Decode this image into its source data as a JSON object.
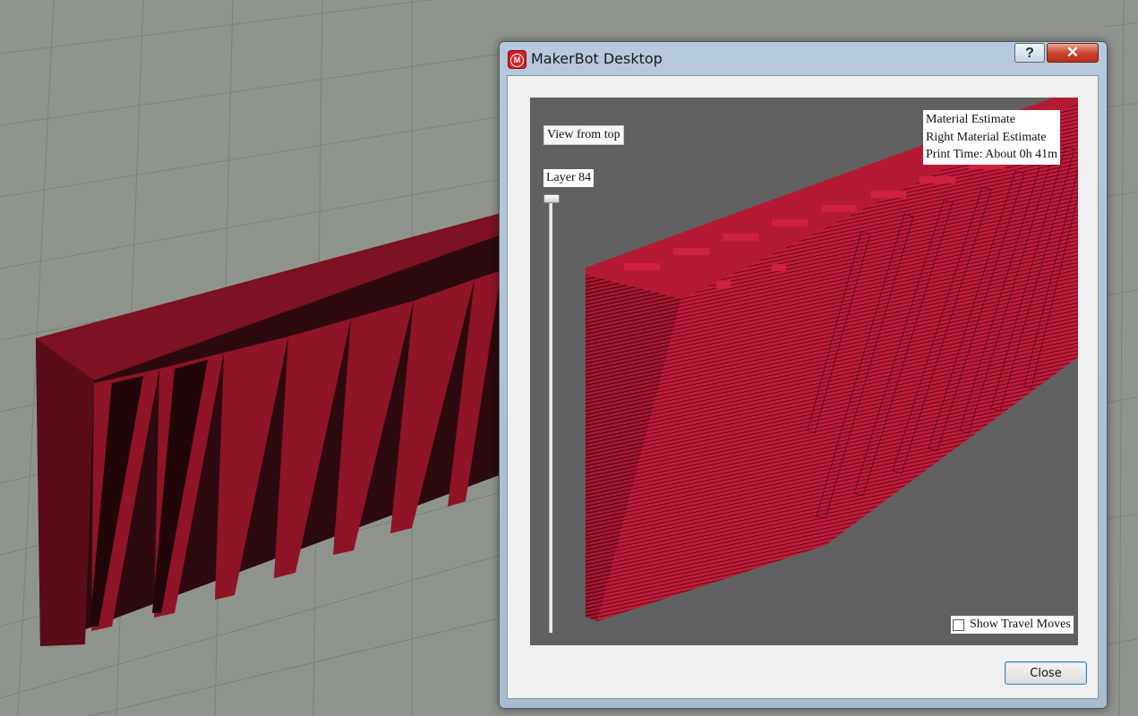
{
  "window": {
    "title": "MakerBot Desktop",
    "help_glyph": "?",
    "close_glyph": "✕",
    "logo_icon": "makerbot-logo-icon"
  },
  "preview": {
    "view_from_top_label": "View from top",
    "layer_label": "Layer 84",
    "estimates": {
      "material": "Material Estimate",
      "right_material": "Right Material Estimate",
      "print_time": "Print Time: About 0h 41m"
    },
    "show_travel_moves_label": "Show Travel Moves",
    "show_travel_moves_checked": false
  },
  "footer": {
    "close_label": "Close"
  },
  "colors": {
    "model_red": "#c41b3b",
    "model_dark": "#2e0b10",
    "viewport_bg": "#606060",
    "grid_bg": "#8f938d"
  }
}
